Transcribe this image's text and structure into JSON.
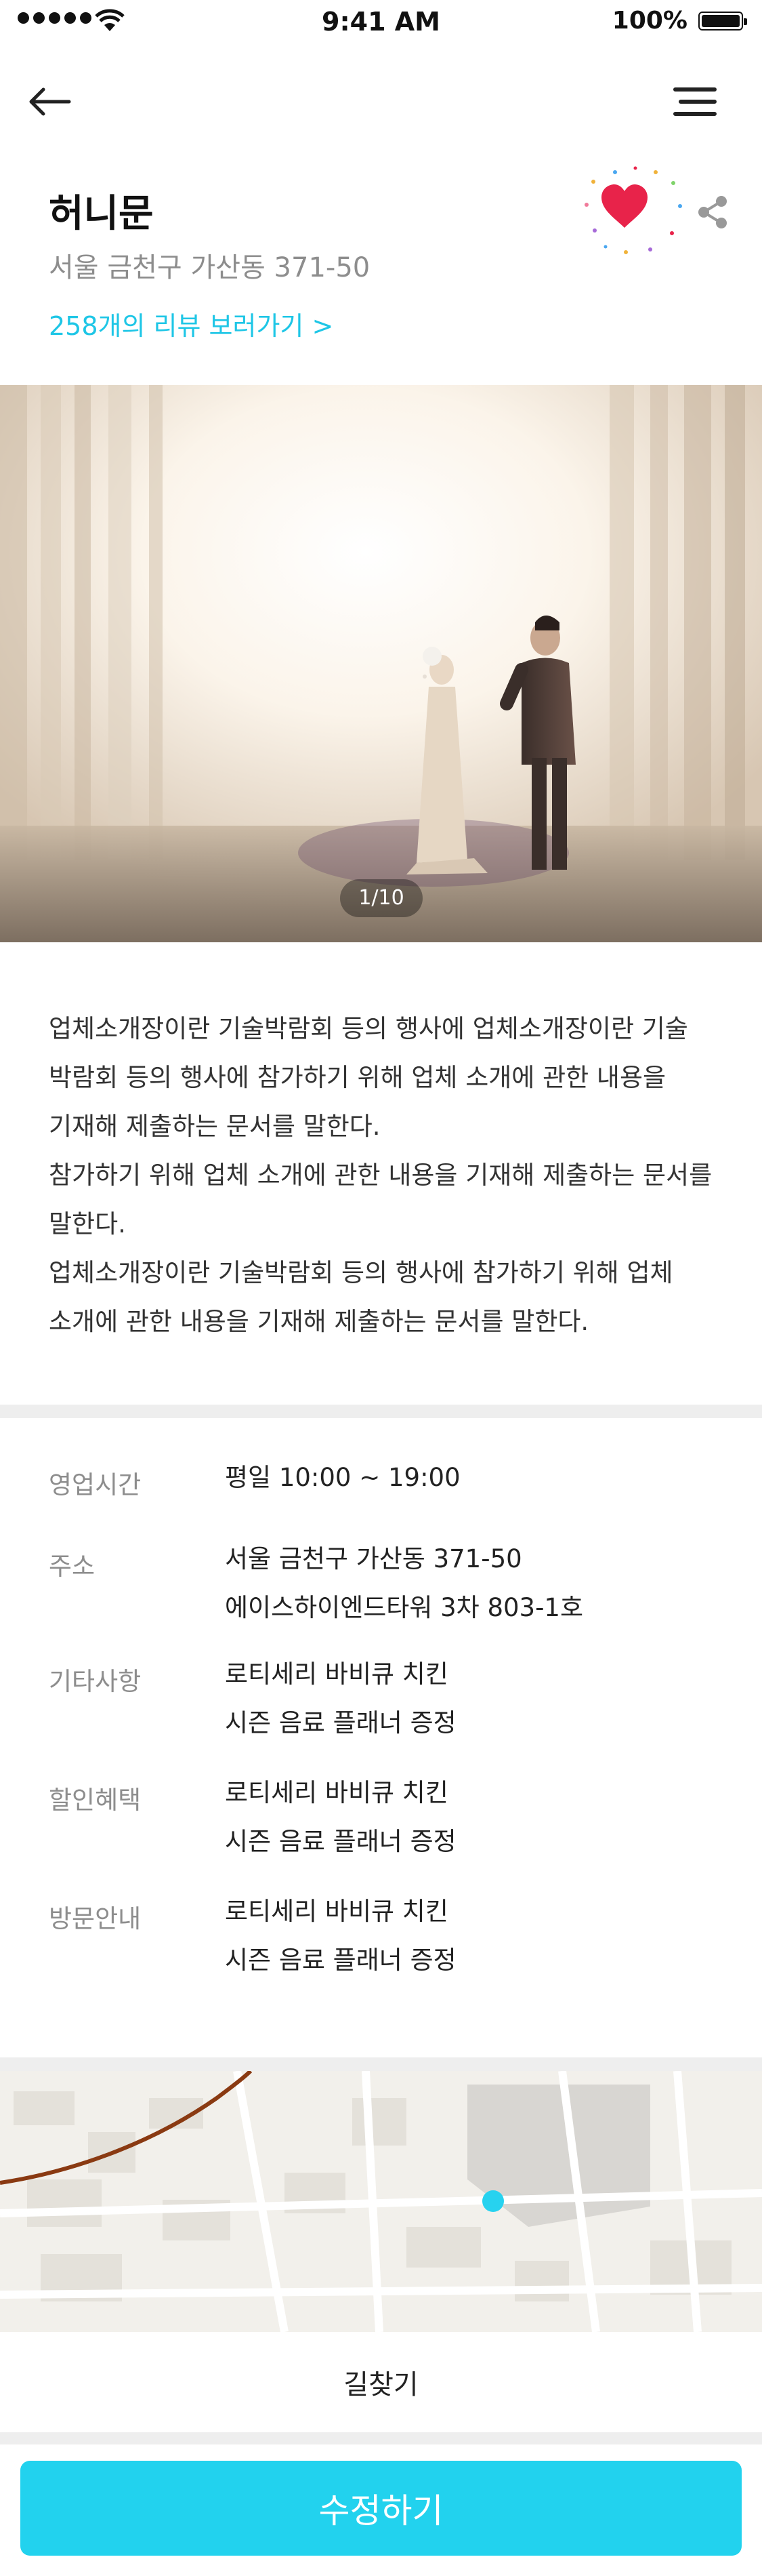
{
  "status_bar": {
    "time": "9:41 AM",
    "battery": "100%"
  },
  "header": {
    "title": "허니문",
    "address": "서울 금천구 가산동 371-50",
    "review_link": "258개의 리뷰 보러가기 >"
  },
  "gallery": {
    "pager": "1/10"
  },
  "description": [
    "업체소개장이란 기술박람회 등의 행사에 업체소개장이란 기술",
    "박람회 등의 행사에 참가하기 위해 업체 소개에 관한 내용을",
    "기재해 제출하는 문서를 말한다.",
    "참가하기 위해 업체 소개에 관한 내용을 기재해 제출하는 문서를",
    "말한다.",
    "업체소개장이란 기술박람회 등의 행사에 참가하기 위해 업체",
    "소개에 관한 내용을 기재해 제출하는 문서를 말한다."
  ],
  "info": {
    "hours": {
      "label": "영업시간",
      "lines": [
        "평일 10:00 ~ 19:00"
      ]
    },
    "address": {
      "label": "주소",
      "lines": [
        "서울 금천구 가산동 371-50",
        "에이스하이엔드타워 3차 803-1호"
      ]
    },
    "etc": {
      "label": "기타사항",
      "lines": [
        "로티세리 바비큐 치킨",
        "시즌 음료 플래너 증정"
      ]
    },
    "discount": {
      "label": "할인혜택",
      "lines": [
        "로티세리 바비큐 치킨",
        "시즌 음료 플래너 증정"
      ]
    },
    "visit": {
      "label": "방문안내",
      "lines": [
        "로티세리 바비큐 치킨",
        "시즌 음료 플래너 증정"
      ]
    }
  },
  "map": {
    "directions_label": "길찾기"
  },
  "footer": {
    "edit_label": "수정하기"
  },
  "colors": {
    "accent": "#22d2ee",
    "link": "#1ec6e6",
    "heart": "#e8234a",
    "muted": "#8d8d8d"
  },
  "icons": [
    "back-arrow-icon",
    "menu-icon",
    "heart-icon",
    "share-icon",
    "wifi-icon",
    "battery-icon"
  ]
}
